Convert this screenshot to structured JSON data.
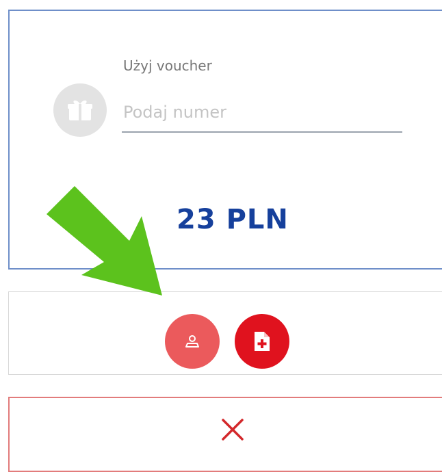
{
  "voucher": {
    "label": "Użyj voucher",
    "placeholder": "Podaj numer",
    "value": ""
  },
  "price": {
    "text": "23 PLN"
  },
  "actions": {
    "person_icon": "person-icon",
    "document_add_icon": "document-plus-icon"
  },
  "cancel": {
    "icon": "close-icon"
  },
  "colors": {
    "panel_border": "#6f8fc9",
    "price": "#16409c",
    "person_button": "#eb5a5c",
    "document_button": "#e0121e",
    "cancel_border": "#e27c7c",
    "cancel_x": "#d3282b",
    "arrow": "#5cc21d",
    "gift_circle": "#e3e3e3"
  }
}
